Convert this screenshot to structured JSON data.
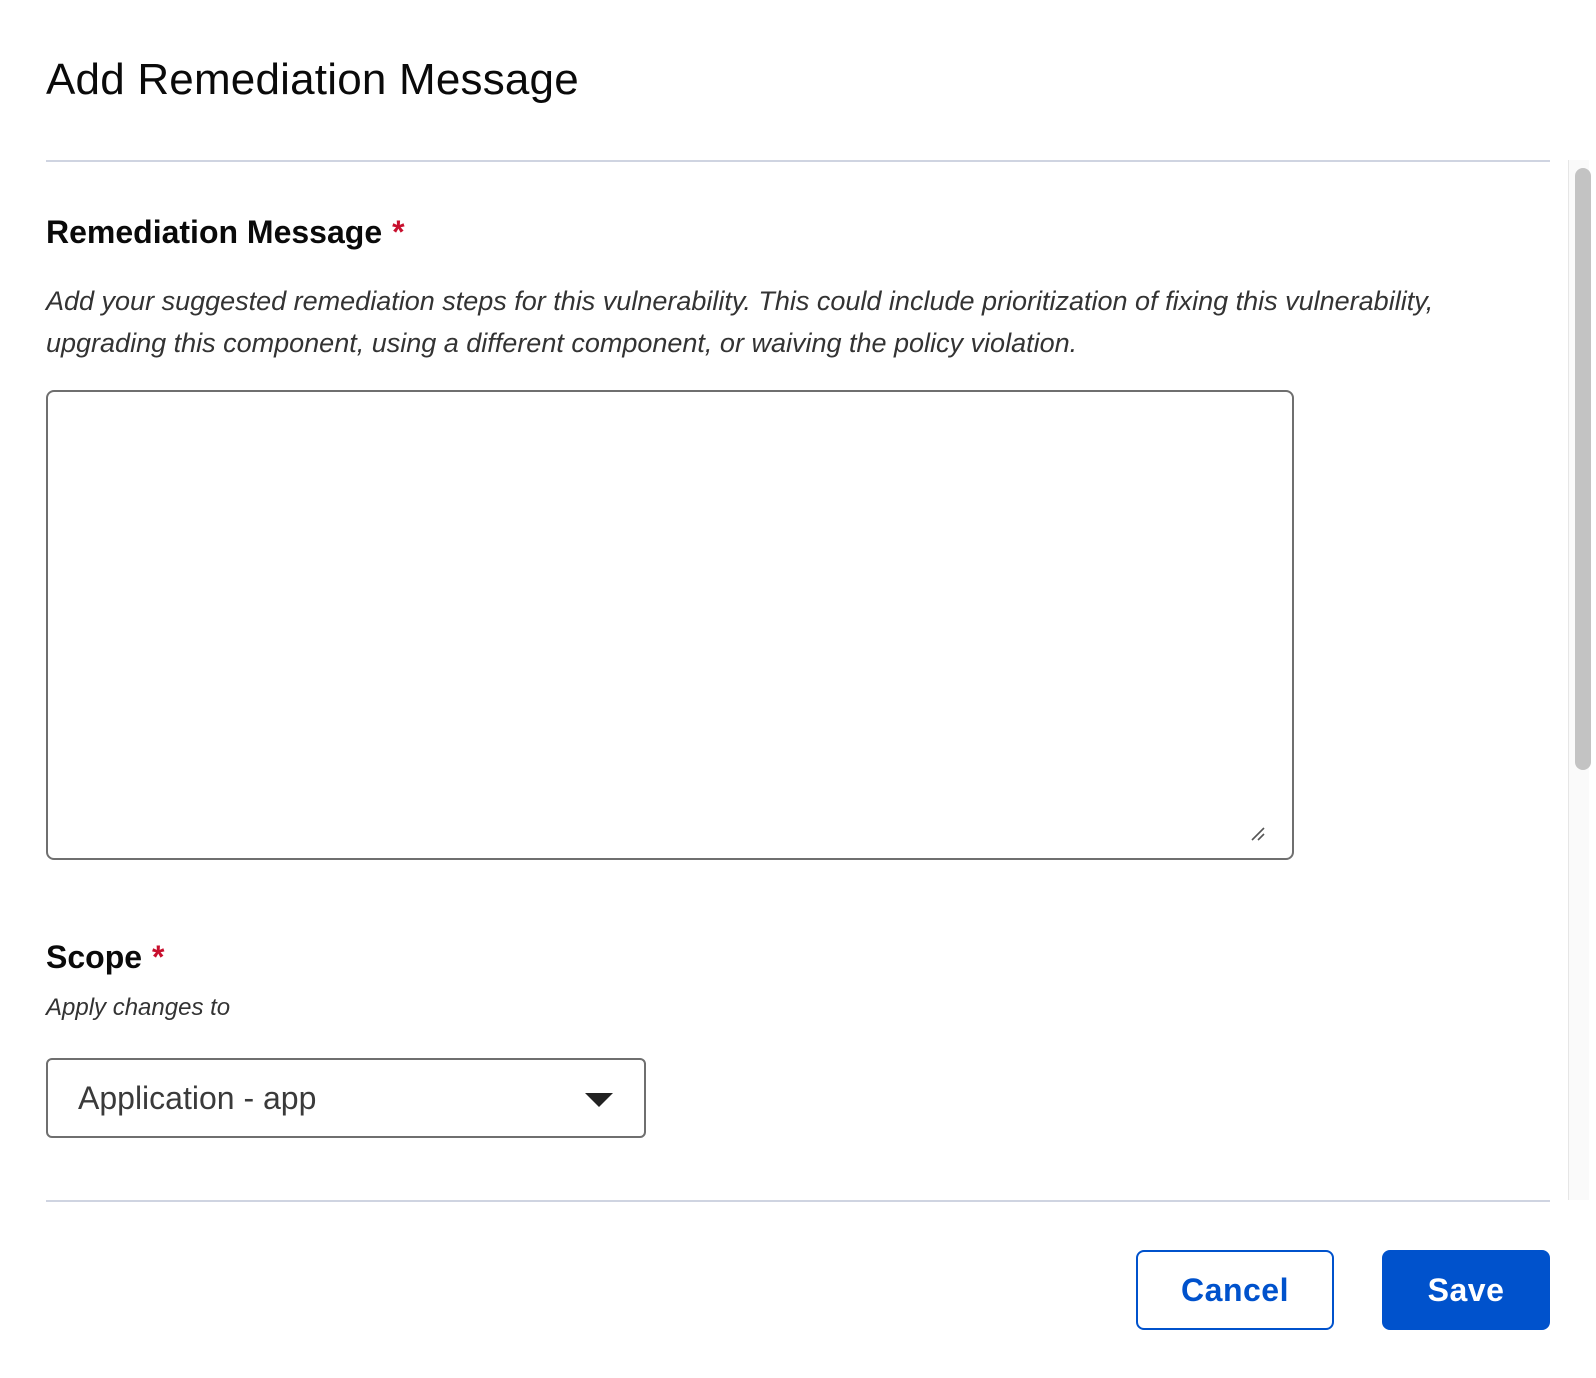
{
  "dialog": {
    "title": "Add Remediation Message"
  },
  "remediation": {
    "label": "Remediation Message",
    "required_mark": "*",
    "help_line1": "Add your suggested remediation steps for this vulnerability. This could include prioritization of fixing this vulnerability,",
    "help_line2": "upgrading this component, using a different component, or waiving the policy violation.",
    "value": "",
    "placeholder": ""
  },
  "scope": {
    "label": "Scope",
    "required_mark": "*",
    "help": "Apply changes to",
    "selected": "Application - app"
  },
  "actions": {
    "cancel_label": "Cancel",
    "save_label": "Save"
  },
  "colors": {
    "primary": "#0052cc",
    "required": "#c8102e",
    "divider": "#cfd4e1",
    "border": "#6f6f6f"
  },
  "icons": {
    "dropdown": "caret-down-icon",
    "resize": "resize-handle-icon"
  }
}
